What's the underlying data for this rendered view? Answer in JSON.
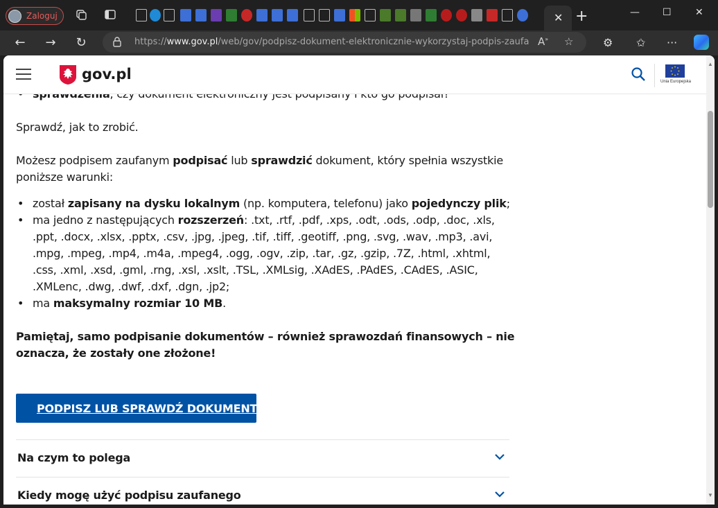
{
  "browser": {
    "profile_label": "Zaloguj",
    "tab_close": "✕",
    "new_tab": "+",
    "url_host": "https://www.gov.pl",
    "url_prefix": "https://",
    "url_domain": "www.gov.pl",
    "url_path": "/web/gov/podpisz-dokument-elektronicznie-wykorzystaj-podpis-zaufa...",
    "minimize": "—",
    "maximize": "☐",
    "close": "✕"
  },
  "site": {
    "brand": "gov.pl",
    "eu_caption": "Unia Europejska",
    "brand_color": "#0052a5"
  },
  "content": {
    "top_item_bold": "sprawdzenia",
    "top_item_rest": ", czy dokument elektroniczny jest podpisany i kto go podpisał?",
    "howto": "Sprawdź, jak to zrobić.",
    "intro_1": "Możesz podpisem zaufanym ",
    "intro_b1": "podpisać",
    "intro_2": " lub ",
    "intro_b2": "sprawdzić",
    "intro_3": " dokument, który spełnia wszystkie poniższe warunki:",
    "cond1_1": "został ",
    "cond1_b1": "zapisany na dysku lokalnym",
    "cond1_2": " (np. komputera, telefonu) jako ",
    "cond1_b2": "pojedynczy plik",
    "cond1_3": ";",
    "cond2_1": "ma jedno z następujących ",
    "cond2_b": "rozszerzeń",
    "cond2_2": ": .txt, .rtf, .pdf, .xps, .odt, .ods, .odp, .doc, .xls, .ppt, .docx, .xlsx, .pptx, .csv, .jpg, .jpeg, .tif, .tiff, .geotiff, .png, .svg, .wav, .mp3, .avi, .mpg, .mpeg, .mp4, .m4a, .mpeg4, .ogg, .ogv, .zip, .tar, .gz, .gzip, .7Z, .html, .xhtml, .css, .xml, .xsd, .gml, .rng, .xsl, .xslt, .TSL, .XMLsig, .XAdES, .PAdES, .CAdES, .ASIC, .XMLenc, .dwg, .dwf, .dxf, .dgn, .jp2;",
    "cond3_1": "ma ",
    "cond3_b": "maksymalny rozmiar 10 MB",
    "cond3_2": ".",
    "note": "Pamiętaj, samo podpisanie dokumentów – również sprawozdań finansowych – nie oznacza, że zostały one złożone!",
    "cta": "PODPISZ LUB SPRAWDŹ DOKUMENT"
  },
  "accordion": [
    {
      "title": "Na czym to polega"
    },
    {
      "title": "Kiedy mogę użyć podpisu zaufanego"
    }
  ]
}
